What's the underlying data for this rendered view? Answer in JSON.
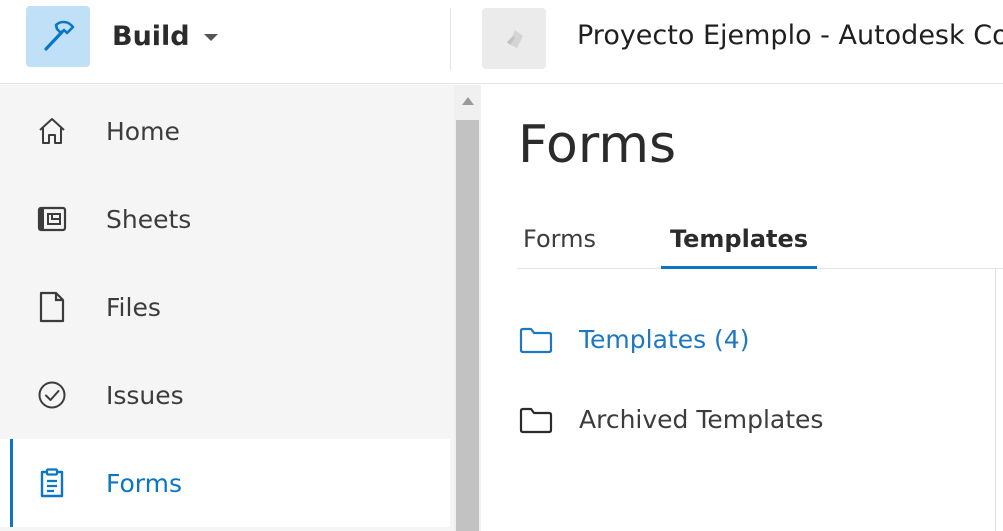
{
  "header": {
    "app_name": "Build",
    "project_name": "Proyecto Ejemplo - Autodesk Co"
  },
  "sidebar": {
    "items": [
      {
        "label": "Home",
        "icon": "home-icon"
      },
      {
        "label": "Sheets",
        "icon": "sheets-icon"
      },
      {
        "label": "Files",
        "icon": "file-icon"
      },
      {
        "label": "Issues",
        "icon": "check-circle-icon"
      },
      {
        "label": "Forms",
        "icon": "clipboard-icon",
        "active": true
      }
    ]
  },
  "main": {
    "title": "Forms",
    "tabs": [
      {
        "label": "Forms"
      },
      {
        "label": "Templates",
        "active": true
      }
    ],
    "folders": [
      {
        "label": "Templates (4)",
        "active": true
      },
      {
        "label": "Archived Templates"
      }
    ]
  },
  "colors": {
    "accent": "#0a76c4",
    "app_icon_bg": "#bfe0f7",
    "sidebar_bg": "#f5f5f5"
  }
}
